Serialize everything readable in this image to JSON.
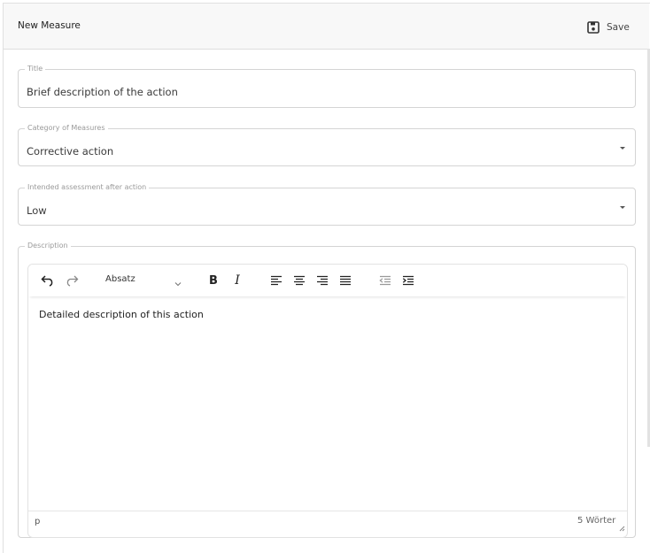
{
  "header": {
    "title": "New Measure",
    "save_label": "Save"
  },
  "fields": {
    "title": {
      "legend": "Title",
      "value": "Brief description of the action"
    },
    "category": {
      "legend": "Category of Measures",
      "value": "Corrective action"
    },
    "assessment": {
      "legend": "Intended assessment after action",
      "value": "Low"
    },
    "description": {
      "legend": "Description"
    }
  },
  "editor": {
    "block_format": "Absatz",
    "bold_label": "B",
    "italic_label": "I",
    "content": "Detailed description of this action",
    "path": "p",
    "word_count": "5 Wörter"
  },
  "icons": [
    "save-icon",
    "undo-icon",
    "redo-icon",
    "chevron-down-icon",
    "align-left-icon",
    "align-center-icon",
    "align-right-icon",
    "justify-icon",
    "outdent-icon",
    "indent-icon",
    "resize-handle-icon"
  ]
}
